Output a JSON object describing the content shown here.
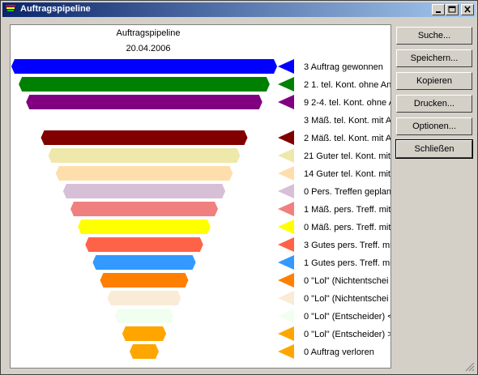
{
  "window": {
    "title": "Auftragspipeline"
  },
  "chart_title": "Auftragspipeline",
  "chart_date": "20.04.2006",
  "buttons": {
    "search": "Suche...",
    "save": "Speichern...",
    "copy": "Kopieren",
    "print": "Drucken...",
    "options": "Optionen...",
    "close": "Schließen"
  },
  "colors": {
    "titlebar_start": "#0a246a",
    "titlebar_end": "#a6caf0",
    "face": "#d4d0c8"
  },
  "chart_data": {
    "type": "funnel",
    "title": "Auftragspipeline",
    "subtitle": "20.04.2006",
    "stages": [
      {
        "label": "3 Auftrag gewonnen",
        "color": "#0000ff",
        "value": 3
      },
      {
        "label": "2 1. tel. Kont. ohne An",
        "color": "#008000",
        "value": 2
      },
      {
        "label": "9 2-4. tel. Kont. ohne A",
        "color": "#800080",
        "value": 9
      },
      {
        "label": "3 Mäß. tel. Kont. mit A",
        "color": null,
        "value": 3
      },
      {
        "label": "2 Mäß. tel. Kont. mit A",
        "color": "#800000",
        "value": 2
      },
      {
        "label": "21 Guter tel. Kont. mit",
        "color": "#eee8aa",
        "value": 21
      },
      {
        "label": "14 Guter tel. Kont. mit",
        "color": "#ffdead",
        "value": 14
      },
      {
        "label": "0 Pers. Treffen geplan",
        "color": "#d8bfd8",
        "value": 0
      },
      {
        "label": "1 Mäß. pers. Treff. mit",
        "color": "#f08080",
        "value": 1
      },
      {
        "label": "0 Mäß. pers. Treff. mit",
        "color": "#ffff00",
        "value": 0
      },
      {
        "label": "3 Gutes pers. Treff. mit",
        "color": "#ff6347",
        "value": 3
      },
      {
        "label": "1 Gutes pers. Treff. mit",
        "color": "#3399ff",
        "value": 1
      },
      {
        "label": "0 \"Lol\" (Nichtentschei",
        "color": "#ff7f00",
        "value": 0
      },
      {
        "label": "0 \"Lol\" (Nichtentschei",
        "color": "#faebd7",
        "value": 0
      },
      {
        "label": "0 \"Lol\" (Entscheider) <",
        "color": "#f0fff0",
        "value": 0
      },
      {
        "label": "0 \"Lol\" (Entscheider) >",
        "color": "#ffa500",
        "value": 0
      },
      {
        "label": "0 Auftrag verloren",
        "color": "#ffa500",
        "value": 0
      }
    ]
  }
}
